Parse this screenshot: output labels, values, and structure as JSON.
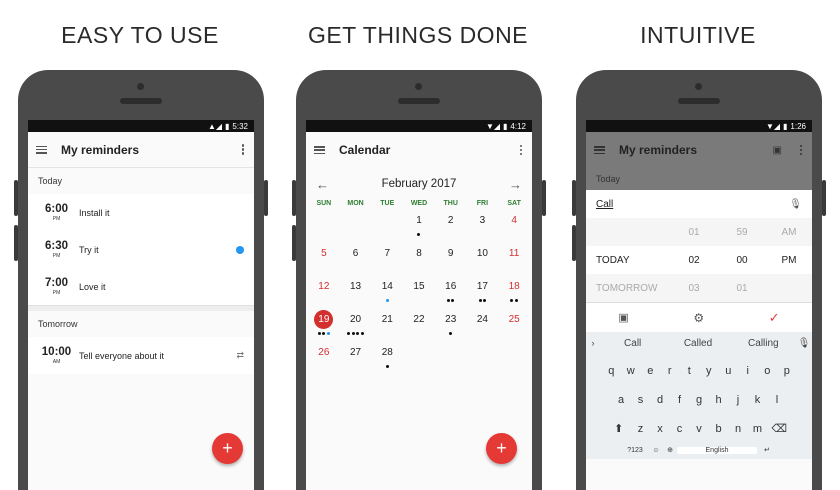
{
  "headlines": [
    "EASY TO USE",
    "GET THINGS DONE",
    "INTUITIVE"
  ],
  "phone1": {
    "status_time": "5:32",
    "title": "My reminders",
    "sections": [
      {
        "label": "Today",
        "items": [
          {
            "time": "6:00",
            "ampm": "PM",
            "text": "Install it"
          },
          {
            "time": "6:30",
            "ampm": "PM",
            "text": "Try it"
          },
          {
            "time": "7:00",
            "ampm": "PM",
            "text": "Love it"
          }
        ]
      },
      {
        "label": "Tomorrow",
        "items": [
          {
            "time": "10:00",
            "ampm": "AM",
            "text": "Tell everyone about it"
          }
        ]
      }
    ],
    "fab_label": "+"
  },
  "phone2": {
    "status_time": "4:12",
    "title": "Calendar",
    "month": "February 2017",
    "weekdays": [
      "SUN",
      "MON",
      "TUE",
      "WED",
      "THU",
      "FRI",
      "SAT"
    ],
    "days": [
      "",
      "",
      "",
      "1",
      "2",
      "3",
      "4",
      "5",
      "6",
      "7",
      "8",
      "9",
      "10",
      "11",
      "12",
      "13",
      "14",
      "15",
      "16",
      "17",
      "18",
      "19",
      "20",
      "21",
      "22",
      "23",
      "24",
      "25",
      "26",
      "27",
      "28"
    ],
    "fab_label": "+"
  },
  "phone3": {
    "status_time": "1:26",
    "title": "My reminders",
    "section": "Today",
    "input_value": "Call",
    "picker": {
      "rows": [
        [
          "",
          "01",
          "59",
          "AM"
        ],
        [
          "TODAY",
          "02",
          "00",
          "PM"
        ],
        [
          "TOMORROW",
          "03",
          "01",
          ""
        ]
      ]
    },
    "suggestions": [
      "Call",
      "Called",
      "Calling"
    ],
    "keys": {
      "row1": [
        "q",
        "w",
        "e",
        "r",
        "t",
        "y",
        "u",
        "i",
        "o",
        "p"
      ],
      "row2": [
        "a",
        "s",
        "d",
        "f",
        "g",
        "h",
        "j",
        "k",
        "l"
      ],
      "row3": [
        "z",
        "x",
        "c",
        "v",
        "b",
        "n",
        "m"
      ],
      "row4_left": "?123",
      "space": "English"
    }
  }
}
